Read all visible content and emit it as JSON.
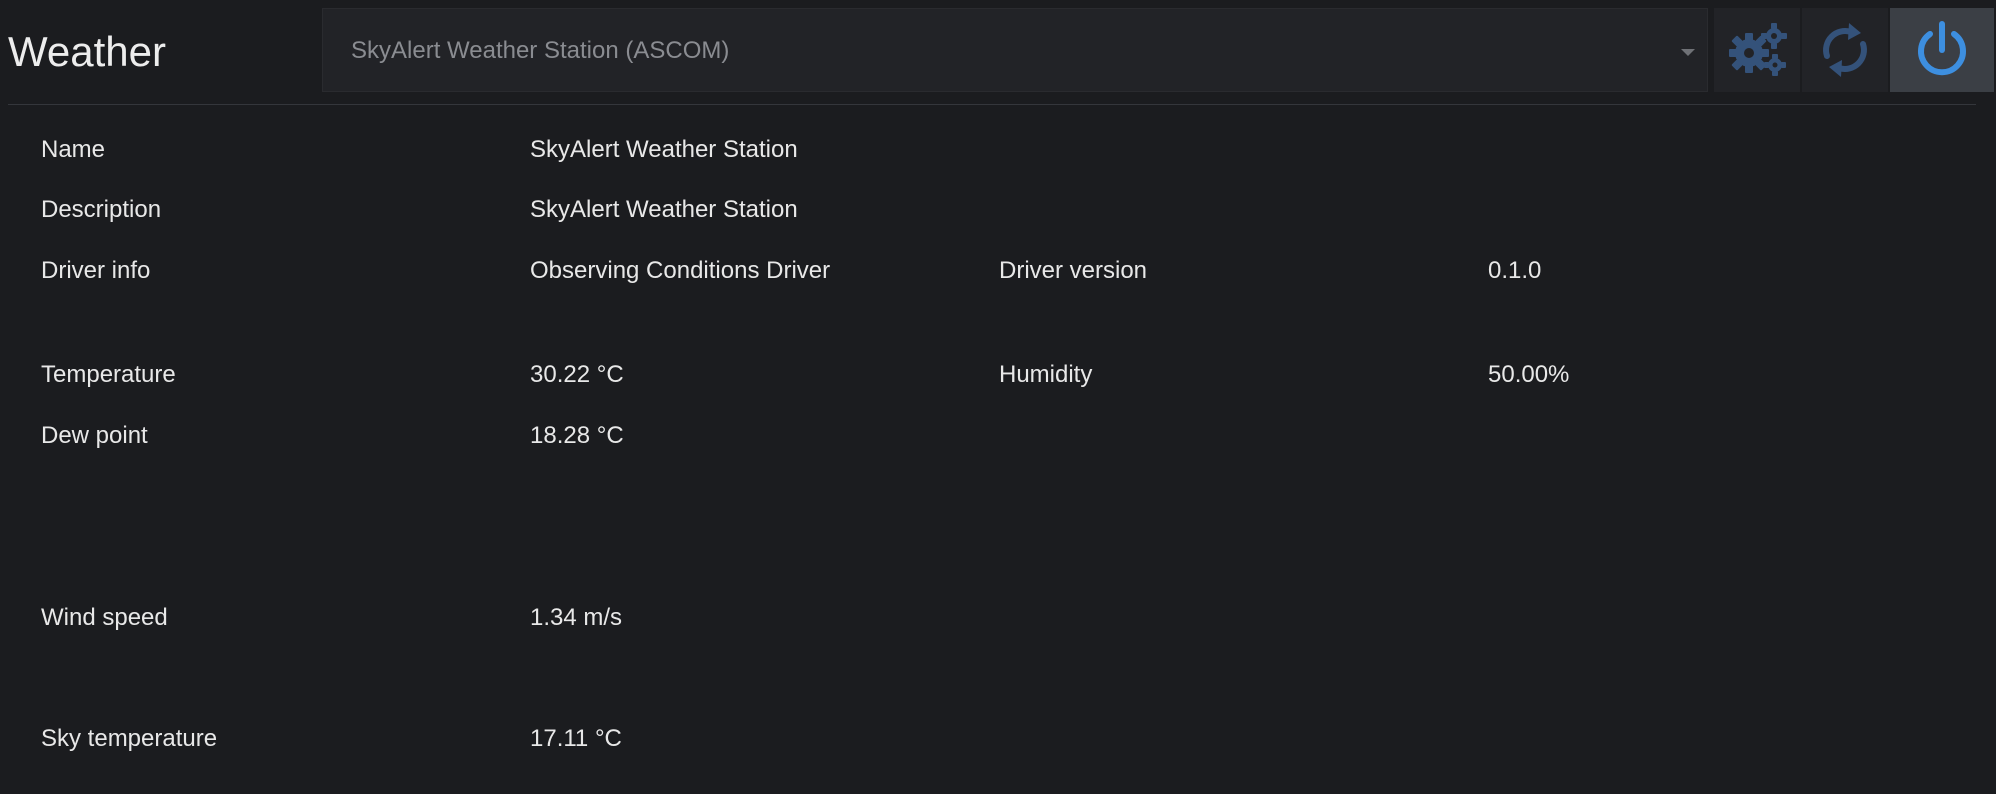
{
  "header": {
    "title": "Weather",
    "device_selector": {
      "value": "SkyAlert Weather Station (ASCOM)"
    },
    "buttons": {
      "settings_icon": "gears-icon",
      "refresh_icon": "refresh-icon",
      "power_icon": "power-icon"
    }
  },
  "info": {
    "name": {
      "label": "Name",
      "value": "SkyAlert Weather Station"
    },
    "description": {
      "label": "Description",
      "value": "SkyAlert Weather Station"
    },
    "driver_info": {
      "label": "Driver info",
      "value": "Observing Conditions Driver"
    },
    "driver_version": {
      "label": "Driver version",
      "value": "0.1.0"
    }
  },
  "readings": {
    "temperature": {
      "label": "Temperature",
      "value": "30.22 °C"
    },
    "humidity": {
      "label": "Humidity",
      "value": "50.00%"
    },
    "dew_point": {
      "label": "Dew point",
      "value": "18.28 °C"
    },
    "wind_speed": {
      "label": "Wind speed",
      "value": "1.34 m/s"
    },
    "sky_temperature": {
      "label": "Sky temperature",
      "value": "17.11 °C"
    }
  },
  "colors": {
    "background": "#1b1c1f",
    "panel": "#222327",
    "accent": "#3d8fe0",
    "muted_icon": "#34527a",
    "text": "#e8e8e8"
  }
}
